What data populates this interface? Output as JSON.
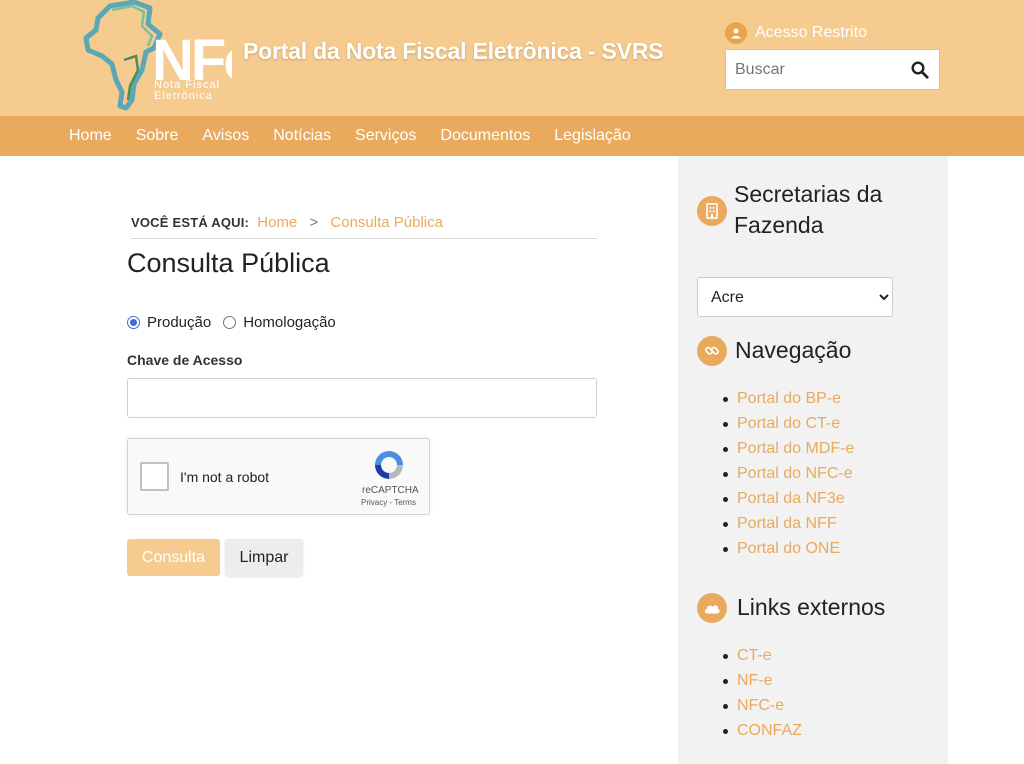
{
  "header": {
    "logo_text": "NFe",
    "logo_subtext": "Nota Fiscal Eletrônica",
    "site_title": "Portal da Nota Fiscal Eletrônica - SVRS",
    "restricted_access": "Acesso Restrito",
    "search_placeholder": "Buscar"
  },
  "nav": {
    "items": [
      {
        "label": "Home"
      },
      {
        "label": "Sobre"
      },
      {
        "label": "Avisos"
      },
      {
        "label": "Notícias"
      },
      {
        "label": "Serviços"
      },
      {
        "label": "Documentos"
      },
      {
        "label": "Legislação"
      }
    ]
  },
  "breadcrumb": {
    "label": "VOCÊ ESTÁ AQUI:",
    "items": [
      {
        "label": "Home"
      },
      {
        "label": "Consulta Pública"
      }
    ],
    "separator": ">"
  },
  "main": {
    "title": "Consulta Pública",
    "radio_options": [
      {
        "label": "Produção",
        "checked": true
      },
      {
        "label": "Homologação",
        "checked": false
      }
    ],
    "field_label": "Chave de Acesso",
    "field_value": "",
    "captcha": {
      "label": "I'm not a robot",
      "brand": "reCAPTCHA",
      "terms": "Privacy - Terms"
    },
    "submit_label": "Consulta",
    "clear_label": "Limpar"
  },
  "sidebar": {
    "secretarias": {
      "title": "Secretarias da Fazenda",
      "selected": "Acre"
    },
    "navegacao": {
      "title": "Navegação",
      "links": [
        {
          "label": "Portal do BP-e"
        },
        {
          "label": "Portal do CT-e"
        },
        {
          "label": "Portal do MDF-e"
        },
        {
          "label": "Portal do NFC-e"
        },
        {
          "label": "Portal da NF3e"
        },
        {
          "label": "Portal da NFF"
        },
        {
          "label": "Portal do ONE"
        }
      ]
    },
    "externos": {
      "title": "Links externos",
      "links": [
        {
          "label": "CT-e"
        },
        {
          "label": "NF-e"
        },
        {
          "label": "NFC-e"
        },
        {
          "label": "CONFAZ"
        }
      ]
    }
  },
  "colors": {
    "header_bg": "#f5cb90",
    "nav_bg": "#e9aa5e",
    "accent": "#e9aa5e",
    "sidebar_bg": "#f2f2f2"
  },
  "icons": {
    "user": "user-icon",
    "search": "search-icon",
    "building": "building-icon",
    "link": "link-icon",
    "cloud": "cloud-icon"
  }
}
